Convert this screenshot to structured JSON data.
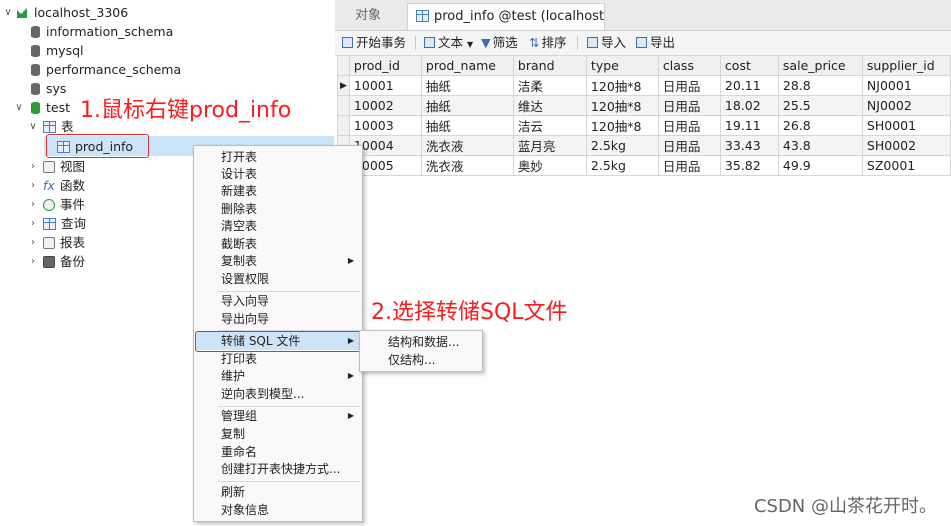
{
  "tree": {
    "connection": "localhost_3306",
    "databases": [
      "information_schema",
      "mysql",
      "performance_schema",
      "sys",
      "test"
    ],
    "test_children": {
      "tables_label": "表",
      "selected_table": "prod_info",
      "groups": [
        "视图",
        "函数",
        "事件",
        "查询",
        "报表",
        "备份"
      ]
    }
  },
  "annotations": {
    "step1": "1.鼠标右键prod_info",
    "step2": "2.选择转储SQL文件"
  },
  "tabs": {
    "objects": "对象",
    "active": "prod_info @test (localhost_..."
  },
  "toolbar": {
    "begin_transaction": "开始事务",
    "text": "文本",
    "filter": "筛选",
    "sort": "排序",
    "import": "导入",
    "export": "导出"
  },
  "grid": {
    "columns": [
      "prod_id",
      "prod_name",
      "brand",
      "type",
      "class",
      "cost",
      "sale_price",
      "supplier_id"
    ],
    "rows": [
      [
        "10001",
        "抽纸",
        "洁柔",
        "120抽*8",
        "日用品",
        "20.11",
        "28.8",
        "NJ0001"
      ],
      [
        "10002",
        "抽纸",
        "维达",
        "120抽*8",
        "日用品",
        "18.02",
        "25.5",
        "NJ0002"
      ],
      [
        "10003",
        "抽纸",
        "洁云",
        "120抽*8",
        "日用品",
        "19.11",
        "26.8",
        "SH0001"
      ],
      [
        "10004",
        "洗衣液",
        "蓝月亮",
        "2.5kg",
        "日用品",
        "33.43",
        "43.8",
        "SH0002"
      ],
      [
        "10005",
        "洗衣液",
        "奥妙",
        "2.5kg",
        "日用品",
        "35.82",
        "49.9",
        "SZ0001"
      ]
    ]
  },
  "context_menu": {
    "items": [
      "打开表",
      "设计表",
      "新建表",
      "删除表",
      "清空表",
      "截断表",
      "复制表",
      "设置权限",
      "导入向导",
      "导出向导",
      "转储 SQL 文件",
      "打印表",
      "维护",
      "逆向表到模型...",
      "管理组",
      "复制",
      "重命名",
      "创建打开表快捷方式...",
      "刷新",
      "对象信息"
    ]
  },
  "submenu": {
    "items": [
      "结构和数据...",
      "仅结构..."
    ]
  },
  "watermark": "CSDN @山茶花开时。",
  "colors": {
    "annotation": "#ff1a1a",
    "selection": "#cce4f7",
    "db_active": "#2b9a3a"
  }
}
